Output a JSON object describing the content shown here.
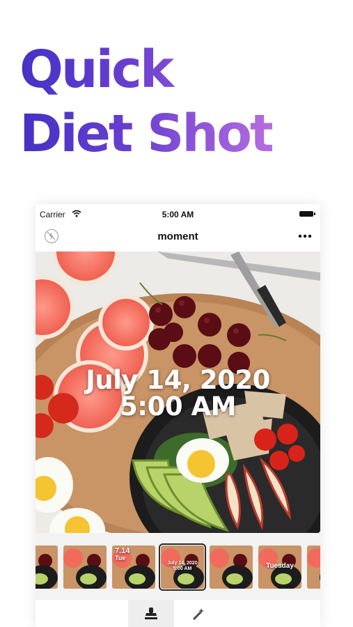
{
  "headline": {
    "line1": "Quick",
    "line2": "Diet Shot"
  },
  "status_bar": {
    "carrier": "Carrier",
    "time": "5:00 AM"
  },
  "nav": {
    "title": "moment",
    "left_icon": "flash-off-icon",
    "right_icon": "more-icon"
  },
  "photo": {
    "stamp_date": "July 14, 2020",
    "stamp_time": "5:00 AM"
  },
  "thumbnails": [
    {
      "label": ""
    },
    {
      "label": ""
    },
    {
      "label_line1": "7.14",
      "label_line2": "Tue"
    },
    {
      "label_line1": "July 14, 2020",
      "label_line2": "5:00 AM",
      "selected": true
    },
    {
      "label": ""
    },
    {
      "label": "Tuesday"
    },
    {
      "label": ""
    }
  ],
  "tabs": [
    {
      "icon": "stamp-icon",
      "active": true
    },
    {
      "icon": "magic-wand-icon",
      "active": false
    }
  ],
  "colors": {
    "headline_start": "#4432c4",
    "headline_end": "#b56ee0",
    "accent": "#2b2b2b"
  }
}
